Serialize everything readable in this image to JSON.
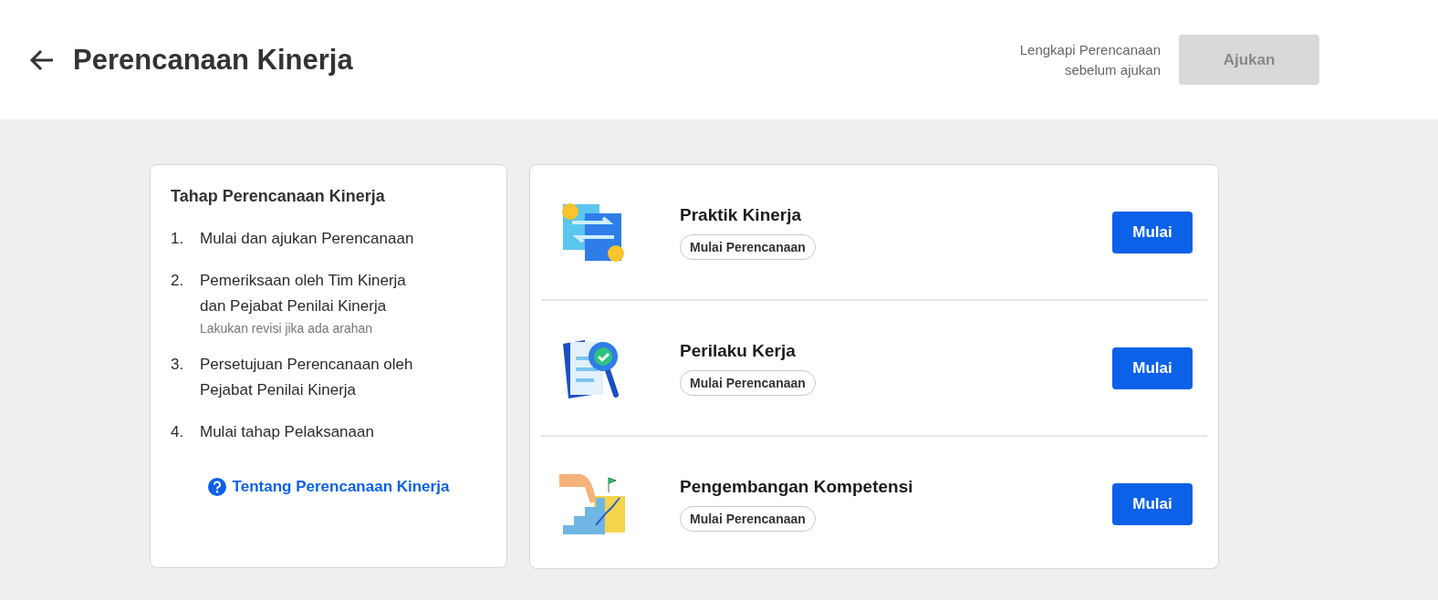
{
  "header": {
    "title": "Perencanaan Kinerja",
    "note_lines": [
      "Lengkapi Perencanaan",
      "sebelum ajukan"
    ],
    "submit": {
      "label": "Ajukan",
      "disabled": true
    }
  },
  "stages": {
    "title": "Tahap Perencanaan Kinerja",
    "steps": [
      {
        "number": "1.",
        "lines": [
          "Mulai dan ajukan Perencanaan"
        ]
      },
      {
        "number": "2.",
        "lines": [
          "Pemeriksaan oleh Tim Kinerja",
          "dan Pejabat Penilai Kinerja"
        ],
        "hint": "Lakukan revisi jika ada arahan"
      },
      {
        "number": "3.",
        "lines": [
          "Persetujuan Perencanaan oleh",
          "Pejabat Penilai Kinerja"
        ]
      },
      {
        "number": "4.",
        "lines": [
          "Mulai tahap Pelaksanaan"
        ]
      }
    ],
    "link": "Tentang Perencanaan Kinerja"
  },
  "sections": [
    {
      "kind": "practice",
      "title": "Praktik Kinerja",
      "status": "Mulai Perencanaan",
      "button": "Mulai"
    },
    {
      "kind": "behavior",
      "title": "Perilaku Kerja",
      "status": "Mulai Perencanaan",
      "button": "Mulai"
    },
    {
      "kind": "growth",
      "title": "Pengembangan Kompetensi",
      "status": "Mulai Perencanaan",
      "button": "Mulai"
    }
  ]
}
